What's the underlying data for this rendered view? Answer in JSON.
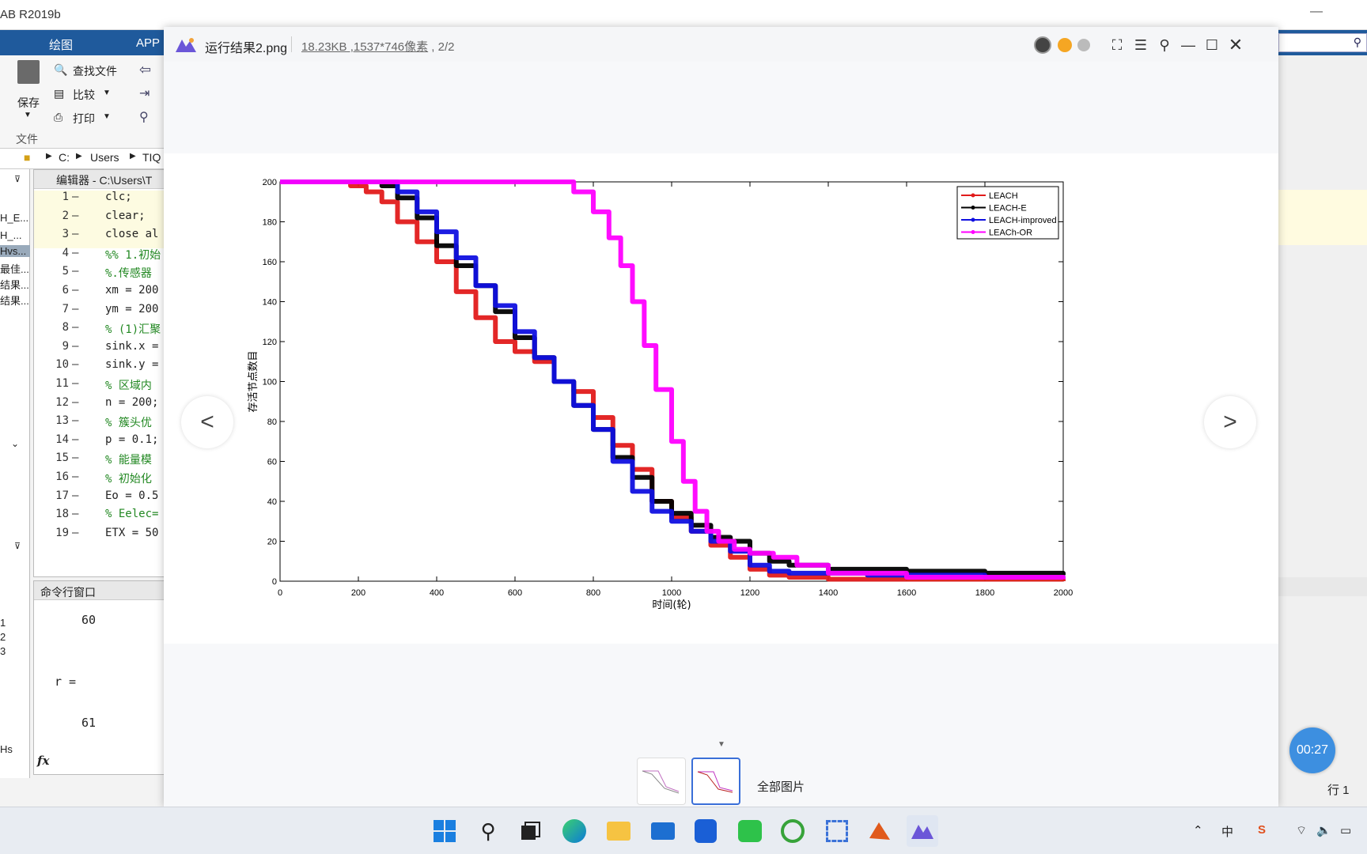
{
  "matlab": {
    "title": "AB R2019b",
    "tabs": [
      "绘图",
      "APP"
    ],
    "ribbon": {
      "find_files": "查找文件",
      "compare": "比较",
      "print": "打印",
      "save": "保存",
      "file_group": "文件"
    },
    "path": [
      "C:",
      "Users",
      "TIQ"
    ],
    "editor_title": "编辑器 - C:\\Users\\T",
    "left_files": [
      "H_E...",
      "H_...",
      "Hvs...",
      "最佳...",
      "结果...",
      "结果..."
    ],
    "code_lines": [
      {
        "n": "1",
        "code": "clc;",
        "comment": false
      },
      {
        "n": "2",
        "code": "clear;",
        "comment": false
      },
      {
        "n": "3",
        "code": "close al",
        "comment": false
      },
      {
        "n": "4",
        "code": "%% 1.初始",
        "comment": true
      },
      {
        "n": "5",
        "code": "%.传感器",
        "comment": true
      },
      {
        "n": "6",
        "code": "xm = 200",
        "comment": false
      },
      {
        "n": "7",
        "code": "ym = 200",
        "comment": false
      },
      {
        "n": "8",
        "code": "% (1)汇聚",
        "comment": true
      },
      {
        "n": "9",
        "code": "sink.x =",
        "comment": false
      },
      {
        "n": "10",
        "code": "sink.y =",
        "comment": false
      },
      {
        "n": "11",
        "code": "% 区域内",
        "comment": true
      },
      {
        "n": "12",
        "code": "n = 200;",
        "comment": false
      },
      {
        "n": "13",
        "code": "% 簇头优",
        "comment": true
      },
      {
        "n": "14",
        "code": "p = 0.1;",
        "comment": false
      },
      {
        "n": "15",
        "code": "% 能量模",
        "comment": true
      },
      {
        "n": "16",
        "code": "% 初始化",
        "comment": true
      },
      {
        "n": "17",
        "code": "Eo = 0.5",
        "comment": false
      },
      {
        "n": "18",
        "code": "% Eelec=",
        "comment": true
      },
      {
        "n": "19",
        "code": "ETX = 50",
        "comment": false
      }
    ],
    "cmd_title": "命令行窗口",
    "cmd_out1": "60",
    "cmd_out2": "r =",
    "cmd_out3": "61",
    "fx": "fx",
    "left_nums": [
      "1",
      "2",
      "3"
    ],
    "left_hs": "Hs",
    "status_row": "行 1"
  },
  "viewer": {
    "file_name": "运行结果2.png",
    "file_size": "18.23KB",
    "dimensions": "1537*746像素",
    "index": "2/2",
    "all_images": "全部图片",
    "prev_label": "<",
    "next_label": ">"
  },
  "timer": "00:27",
  "chart_data": {
    "type": "line",
    "title": "",
    "xlabel": "时间(轮)",
    "ylabel": "存活节点数目",
    "xlim": [
      0,
      2000
    ],
    "ylim": [
      0,
      200
    ],
    "xticks": [
      0,
      200,
      400,
      600,
      800,
      1000,
      1200,
      1400,
      1600,
      1800,
      2000
    ],
    "yticks": [
      0,
      20,
      40,
      60,
      80,
      100,
      120,
      140,
      160,
      180,
      200
    ],
    "legend_position": "top-right",
    "series": [
      {
        "name": "LEACH",
        "color": "#e11b1b",
        "marker": "x",
        "x": [
          0,
          150,
          180,
          220,
          260,
          300,
          350,
          400,
          450,
          500,
          550,
          600,
          650,
          700,
          750,
          800,
          850,
          900,
          950,
          1000,
          1050,
          1100,
          1150,
          1200,
          1250,
          1300,
          1400,
          1600,
          2000
        ],
        "y": [
          200,
          200,
          198,
          195,
          190,
          180,
          170,
          160,
          145,
          132,
          120,
          115,
          110,
          100,
          95,
          82,
          68,
          56,
          40,
          32,
          25,
          18,
          12,
          6,
          3,
          2,
          1,
          1,
          0
        ]
      },
      {
        "name": "LEACH-E",
        "color": "#000000",
        "marker": "o",
        "x": [
          0,
          230,
          260,
          300,
          350,
          400,
          450,
          500,
          550,
          600,
          650,
          700,
          750,
          800,
          850,
          900,
          950,
          1000,
          1050,
          1100,
          1150,
          1200,
          1250,
          1300,
          1400,
          1600,
          1800,
          2000
        ],
        "y": [
          200,
          200,
          198,
          192,
          182,
          168,
          158,
          148,
          135,
          122,
          112,
          100,
          88,
          76,
          62,
          52,
          40,
          34,
          28,
          22,
          20,
          14,
          10,
          8,
          6,
          5,
          4,
          3
        ]
      },
      {
        "name": "LEACH-improved",
        "color": "#1010e0",
        "marker": "^",
        "x": [
          0,
          270,
          300,
          350,
          400,
          450,
          500,
          550,
          600,
          650,
          700,
          750,
          800,
          850,
          900,
          950,
          1000,
          1050,
          1100,
          1150,
          1200,
          1250,
          1300,
          1500,
          1800,
          2000
        ],
        "y": [
          200,
          200,
          195,
          185,
          175,
          162,
          148,
          138,
          125,
          112,
          100,
          88,
          76,
          60,
          45,
          35,
          30,
          25,
          20,
          15,
          8,
          5,
          4,
          3,
          2,
          1
        ]
      },
      {
        "name": "LEACh-OR",
        "color": "#ff00ff",
        "marker": "*",
        "x": [
          0,
          720,
          750,
          800,
          840,
          870,
          900,
          930,
          960,
          1000,
          1030,
          1060,
          1090,
          1120,
          1160,
          1200,
          1260,
          1320,
          1400,
          1600,
          2000
        ],
        "y": [
          200,
          200,
          195,
          185,
          172,
          158,
          140,
          118,
          96,
          70,
          50,
          35,
          25,
          20,
          16,
          14,
          12,
          8,
          4,
          2,
          1
        ]
      }
    ]
  }
}
